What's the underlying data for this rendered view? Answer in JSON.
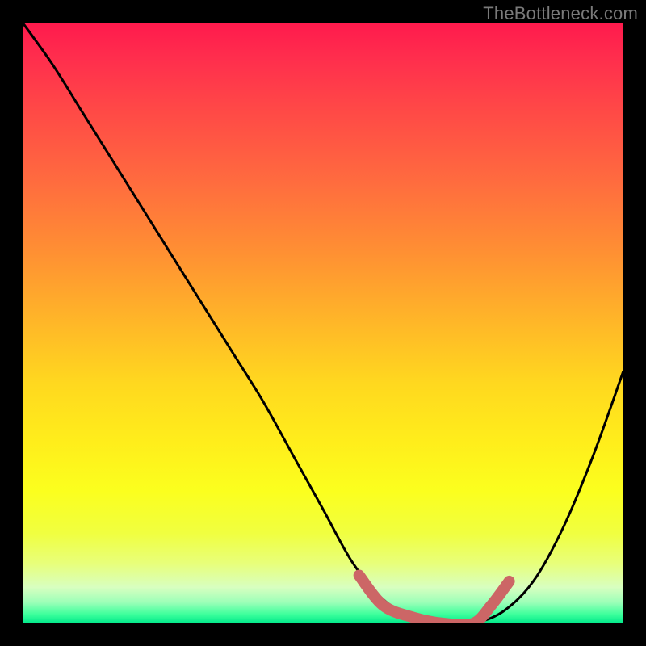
{
  "watermark": {
    "text": "TheBottleneck.com"
  },
  "colors": {
    "background": "#000000",
    "curve": "#000000",
    "highlight": "#cc6666",
    "gradient_top": "#ff1a4d",
    "gradient_bottom": "#00e88a"
  },
  "chart_data": {
    "type": "line",
    "title": "",
    "xlabel": "",
    "ylabel": "",
    "xlim": [
      0,
      100
    ],
    "ylim": [
      0,
      100
    ],
    "grid": false,
    "legend": false,
    "series": [
      {
        "name": "bottleneck-curve",
        "x": [
          0,
          5,
          10,
          15,
          20,
          25,
          30,
          35,
          40,
          45,
          50,
          55,
          60,
          65,
          70,
          75,
          80,
          85,
          90,
          95,
          100
        ],
        "y": [
          100,
          93,
          85,
          77,
          69,
          61,
          53,
          45,
          37,
          28,
          19,
          10,
          4,
          1,
          0,
          0,
          2,
          7,
          16,
          28,
          42
        ]
      }
    ],
    "annotations": [
      {
        "name": "optimal-zone-highlight",
        "x": [
          56,
          60,
          65,
          70,
          75,
          78,
          81
        ],
        "y": [
          8,
          3,
          1,
          0,
          0,
          3,
          7
        ]
      }
    ]
  }
}
